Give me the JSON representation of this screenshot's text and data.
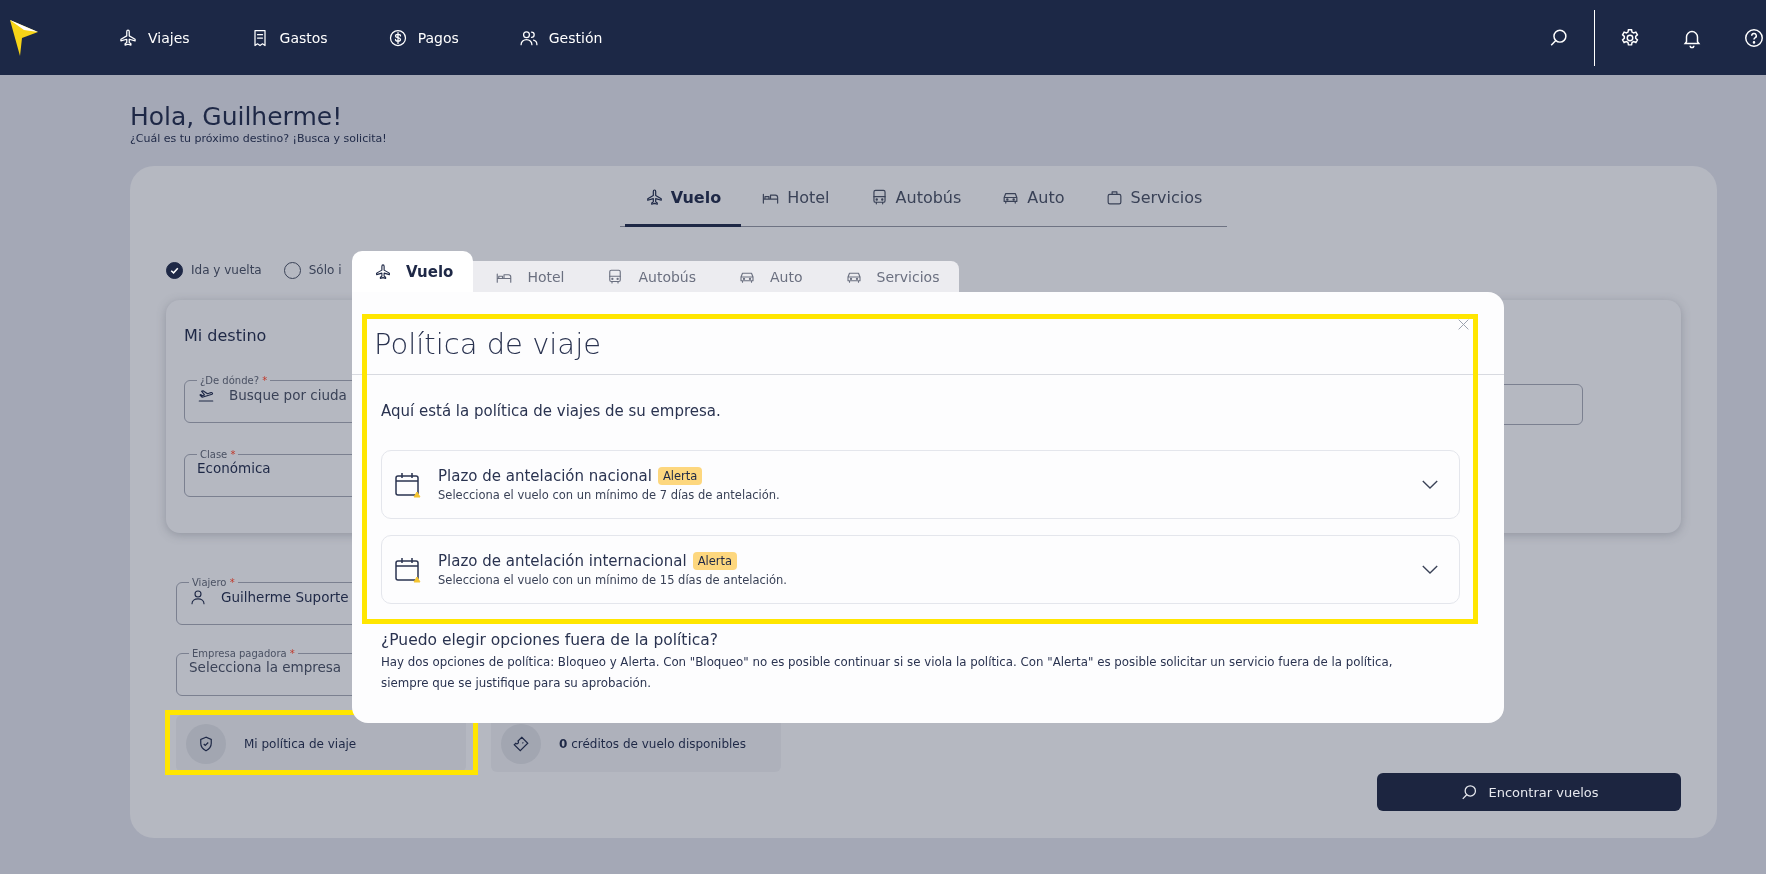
{
  "nav": {
    "items": [
      {
        "label": "Viajes",
        "kind": "plane"
      },
      {
        "label": "Gastos",
        "kind": "receipt"
      },
      {
        "label": "Pagos",
        "kind": "dollar"
      },
      {
        "label": "Gestión",
        "kind": "users"
      }
    ]
  },
  "greeting": {
    "title": "Hola, Guilherme!",
    "subtitle": "¿Cuál es tu próximo destino? ¡Busca y solicita!"
  },
  "search_card": {
    "tabs": [
      {
        "label": "Vuelo",
        "kind": "plane",
        "selected": true
      },
      {
        "label": "Hotel",
        "kind": "bed",
        "selected": false
      },
      {
        "label": "Autobús",
        "kind": "bus",
        "selected": false
      },
      {
        "label": "Auto",
        "kind": "car",
        "selected": false
      },
      {
        "label": "Servicios",
        "kind": "bag",
        "selected": false
      }
    ],
    "trip_types": [
      {
        "label": "Ida y vuelta",
        "selected": true
      },
      {
        "label": "Sólo i",
        "selected": false
      }
    ],
    "destination": {
      "title": "Mi destino",
      "fields": [
        {
          "label": "¿De dónde?",
          "required_mark": "*",
          "placeholder": "Busque por ciuda",
          "kind": "departure"
        },
        {
          "label": "Clase",
          "required_mark": "*",
          "value": "Económica"
        }
      ]
    },
    "traveler_fields": [
      {
        "label": "Viajero",
        "required_mark": "*",
        "value": "Guilherme Suporte",
        "kind": "user"
      },
      {
        "label": "Empresa pagadora",
        "required_mark": "*",
        "placeholder": "Selecciona la empresa"
      }
    ],
    "policy_button": {
      "label": "Mi política de viaje",
      "highlighted": true
    },
    "credits": {
      "text": "**0** créditos de vuelo disponibles"
    },
    "search_button": {
      "label": "Encontrar vuelos"
    }
  },
  "modal": {
    "tabs": [
      {
        "label": "Vuelo",
        "kind": "plane",
        "selected": true
      },
      {
        "label": "Hotel",
        "kind": "bed",
        "selected": false
      },
      {
        "label": "Autobús",
        "kind": "bus",
        "selected": false
      },
      {
        "label": "Auto",
        "kind": "car",
        "selected": false
      },
      {
        "label": "Servicios",
        "kind": "car",
        "selected": false
      }
    ],
    "title": "Política de viaje",
    "highlighted": true,
    "intro": "Aquí está la política de viajes de su empresa.",
    "rules": [
      {
        "title": "Plazo de antelación nacional",
        "badge": "Alerta",
        "description": "Selecciona el vuelo con un mínimo de 7 días de antelación.",
        "expanded": false
      },
      {
        "title": "Plazo de antelación internacional",
        "badge": "Alerta",
        "description": "Selecciona el vuelo con un mínimo de 15 días de antelación.",
        "expanded": false
      }
    ],
    "faq": {
      "question": "¿Puedo elegir opciones fuera de la política?",
      "answer": "Hay dos opciones de política: Bloqueo y Alerta. Con \"Bloqueo\" no es posible continuar si se viola la política. Con \"Alerta\" es posible solicitar un servicio fuera de la política, siempre que se justifique para su aprobación."
    }
  }
}
